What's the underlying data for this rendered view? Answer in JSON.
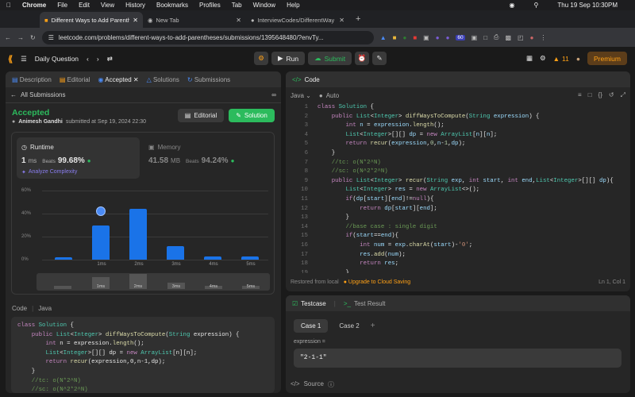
{
  "mac": {
    "app": "Chrome",
    "menus": [
      "File",
      "Edit",
      "View",
      "History",
      "Bookmarks",
      "Profiles",
      "Tab",
      "Window",
      "Help"
    ],
    "datetime": "Thu 19 Sep  10:30PM"
  },
  "browser": {
    "tabs": [
      "Different Ways to Add Parenthe",
      "New Tab",
      "InterviewCodes/DifferentWay"
    ],
    "url": "leetcode.com/problems/different-ways-to-add-parentheses/submissions/1395648480/?envTy...",
    "ext_badge": "60"
  },
  "topbar": {
    "title": "Daily Question",
    "run": "Run",
    "submit": "Submit",
    "streak": "11",
    "premium": "Premium"
  },
  "left": {
    "tabs": [
      "Description",
      "Editorial",
      "Accepted",
      "Solutions",
      "Submissions"
    ],
    "back": "All Submissions",
    "status": "Accepted",
    "author": "Animesh Gandhi",
    "submitted": "submitted at Sep 19, 2024 22:30",
    "editorial_btn": "Editorial",
    "solution_btn": "Solution",
    "runtime": {
      "label": "Runtime",
      "value": "1",
      "unit": "ms",
      "beats_label": "Beats",
      "beats": "99.68%",
      "analyze": "Analyze Complexity"
    },
    "memory": {
      "label": "Memory",
      "value": "41.58",
      "unit": "MB",
      "beats_label": "Beats",
      "beats": "94.24%"
    },
    "code_label": "Code",
    "lang": "Java",
    "code": [
      "class Solution {",
      "    public List<Integer> diffWaysToCompute(String expression) {",
      "        int n = expression.length();",
      "        List<Integer>[][] dp = new ArrayList[n][n];",
      "        return recur(expression,0,n-1,dp);",
      "    }",
      "    //tc: o(N*2^N)",
      "    //sc: o(N^2*2^N)"
    ]
  },
  "chart_data": {
    "type": "bar",
    "categories": [
      "0ms",
      "1ms",
      "2ms",
      "3ms",
      "4ms",
      "5ms"
    ],
    "values": [
      2,
      30,
      44,
      12,
      3,
      3
    ],
    "ylim": [
      0,
      60
    ],
    "yticks": [
      "60%",
      "40%",
      "20%",
      "0%"
    ],
    "xlabels": [
      "1ms",
      "2ms",
      "3ms",
      "4ms",
      "5ms"
    ],
    "highlight": "1ms",
    "minibar": [
      "1ms",
      "2ms",
      "3ms",
      "4ms",
      "5ms"
    ]
  },
  "editor": {
    "header": "Code",
    "lang": "Java",
    "mode": "Auto",
    "lines": [
      "class Solution {",
      "    public List<Integer> diffWaysToCompute(String expression) {",
      "        int n = expression.length();",
      "        List<Integer>[][] dp = new ArrayList[n][n];",
      "        return recur(expression,0,n-1,dp);",
      "    }",
      "    //tc: o(N*2^N)",
      "    //sc: o(N^2*2^N)",
      "    public List<Integer> recur(String exp, int start, int end,List<Integer>[][] dp){",
      "        List<Integer> res = new ArrayList<>();",
      "        if(dp[start][end]!=null){",
      "            return dp[start][end];",
      "        }",
      "        //base case : single digit",
      "        if(start==end){",
      "            int num = exp.charAt(start)-'0';",
      "            res.add(num);",
      "            return res;",
      "        }"
    ],
    "status_left": "Restored from local",
    "upgrade": "Upgrade to Cloud Saving",
    "pos": "Ln 1, Col 1"
  },
  "testcase": {
    "tab1": "Testcase",
    "tab2": "Test Result",
    "cases": [
      "Case 1",
      "Case 2"
    ],
    "param": "expression =",
    "value": "\"2-1-1\"",
    "source": "Source"
  }
}
